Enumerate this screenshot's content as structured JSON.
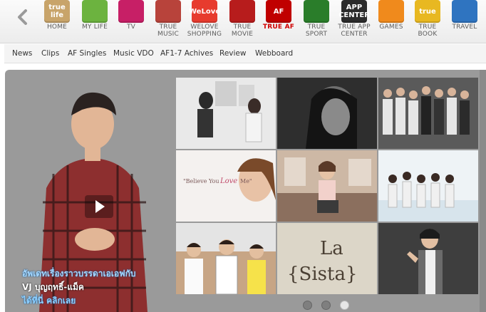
{
  "top_nav": {
    "prev_icon": "chevron-left-icon",
    "apps": [
      {
        "name": "HOME",
        "label": "HOME",
        "badge": "true life",
        "color": "#c8a46a"
      },
      {
        "name": "MY LIFE",
        "label": "MY LIFE",
        "badge": "",
        "color": "#6cb33f"
      },
      {
        "name": "TV",
        "label": "TV",
        "badge": "",
        "color": "#c71f66"
      },
      {
        "name": "TRUE MUSIC",
        "label": "TRUE\nMUSIC",
        "badge": "",
        "color": "#b8433b"
      },
      {
        "name": "WELOVE SHOPPING",
        "label": "WELOVE\nSHOPPING",
        "badge": "WeLove",
        "color": "#e73b2e"
      },
      {
        "name": "TRUE MOVIE",
        "label": "TRUE\nMOVIE",
        "badge": "",
        "color": "#b71c1c"
      },
      {
        "name": "TRUE AF",
        "label": "TRUE AF",
        "badge": "AF",
        "color": "#c00000"
      },
      {
        "name": "TRUE SPORT",
        "label": "TRUE\nSPORT",
        "badge": "",
        "color": "#2a7d2a"
      },
      {
        "name": "TRUE APP CENTER",
        "label": "TRUE APP\nCENTER",
        "badge": "APP CENTER",
        "color": "#2b2b2b"
      },
      {
        "name": "GAMES",
        "label": "GAMES",
        "badge": "",
        "color": "#f08a1c"
      },
      {
        "name": "TRUE BOOK",
        "label": "TRUE\nBOOK",
        "badge": "true",
        "color": "#e8b821"
      },
      {
        "name": "TRAVEL",
        "label": "TRAVEL",
        "badge": "",
        "color": "#2f74c0"
      }
    ]
  },
  "sub_nav": [
    "News",
    "Clips",
    "AF Singles",
    "Music VDO",
    "AF1-7 Achives",
    "Review",
    "Webboard"
  ],
  "feature": {
    "caption_line1": "อัพเดทเรื่องราวบรรดาเอเอฟกับ",
    "caption_line2": "VJ บุญฤทธิ์-แม็ค",
    "caption_line3": "ได้ที่นี่  คลิกเลย"
  },
  "gallery": [
    {
      "name": "tile-duo-sofa",
      "bg": "#e7e7e7"
    },
    {
      "name": "tile-portrait-bw",
      "bg": "#3a3a3a"
    },
    {
      "name": "tile-group-stage",
      "bg": "#555555"
    },
    {
      "name": "tile-love-me",
      "bg": "#f3f0ee",
      "text": "\"Believe You  Love  Me\""
    },
    {
      "name": "tile-girl-sitting",
      "bg": "#cdb8a5"
    },
    {
      "name": "tile-group-beach",
      "bg": "#d9e6ef"
    },
    {
      "name": "tile-three-friends",
      "bg": "#c9a98a"
    },
    {
      "name": "tile-la-sista",
      "bg": "#d8d2c3",
      "text": "La\n{Sista}"
    },
    {
      "name": "tile-singer-rock",
      "bg": "#4a4a4a"
    }
  ],
  "pager": {
    "count": 3,
    "active": 2
  }
}
